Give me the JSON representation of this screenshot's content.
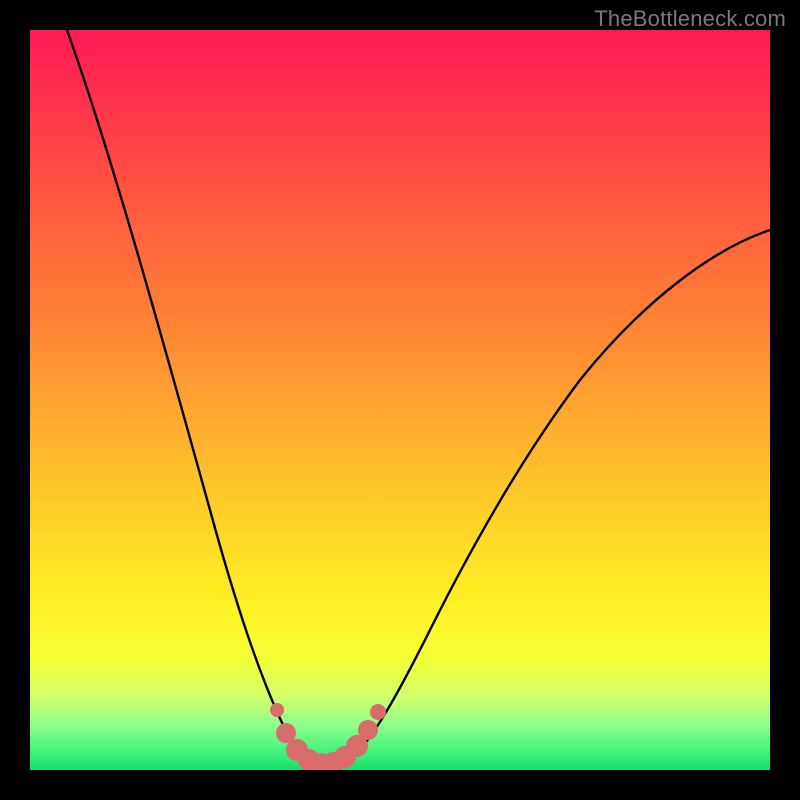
{
  "watermark": {
    "text": "TheBottleneck.com"
  },
  "chart_data": {
    "type": "line",
    "title": "",
    "xlabel": "",
    "ylabel": "",
    "xlim": [
      0,
      100
    ],
    "ylim": [
      0,
      100
    ],
    "background_gradient": {
      "top": "#ff1955",
      "mid": "#ffe628",
      "bottom": "#18e06d"
    },
    "series": [
      {
        "name": "bottleneck-curve",
        "color": "#000000",
        "x": [
          5,
          8,
          11,
          14,
          17,
          20,
          23,
          26,
          29,
          31,
          33,
          35,
          37,
          39,
          41,
          43,
          46,
          50,
          55,
          60,
          66,
          72,
          78,
          85,
          92,
          100
        ],
        "y": [
          100,
          90,
          80,
          70,
          60,
          50,
          41,
          32,
          23,
          16,
          10,
          5,
          2,
          0.5,
          0.5,
          2,
          6,
          12,
          20,
          28,
          36,
          44,
          52,
          60,
          67,
          73
        ]
      }
    ],
    "markers": {
      "name": "highlighted-points",
      "color": "#d96b6b",
      "points": [
        {
          "x": 33.5,
          "y": 8
        },
        {
          "x": 34.5,
          "y": 4
        },
        {
          "x": 36,
          "y": 1.6
        },
        {
          "x": 37.5,
          "y": 0.8
        },
        {
          "x": 39,
          "y": 0.6
        },
        {
          "x": 40.5,
          "y": 0.6
        },
        {
          "x": 42,
          "y": 1.0
        },
        {
          "x": 43.5,
          "y": 2.2
        },
        {
          "x": 45,
          "y": 4.2
        },
        {
          "x": 46.5,
          "y": 7
        }
      ]
    }
  }
}
